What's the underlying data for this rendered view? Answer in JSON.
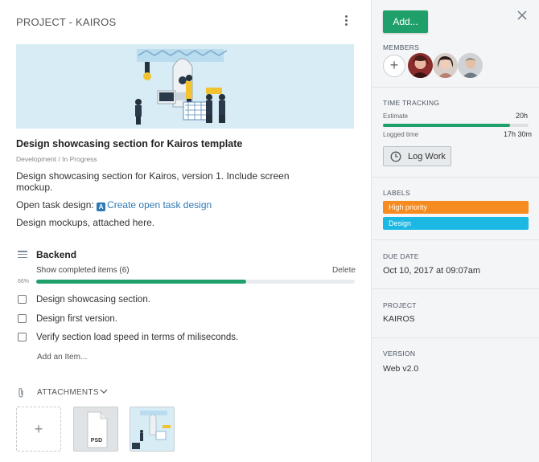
{
  "project": {
    "title": "PROJECT - KAIROS"
  },
  "task": {
    "title": "Design showcasing section for Kairos template",
    "breadcrumb": "Development / In Progress",
    "description": "Design showcasing section for Kairos, version 1. Include screen mockup.",
    "open_task_prefix": "Open task design:",
    "open_task_link": "Create open task design",
    "mockups_note": "Design mockups, attached here."
  },
  "checklist": {
    "title": "Backend",
    "show_completed": "Show completed items (6)",
    "delete_label": "Delete",
    "progress_label": "66%",
    "progress": 0.66,
    "items": [
      {
        "label": "Design showcasing section.",
        "checked": false
      },
      {
        "label": "Design first version.",
        "checked": false
      },
      {
        "label": "Verify section load speed in terms of miliseconds.",
        "checked": false
      }
    ],
    "add_item": "Add an Item..."
  },
  "attachments": {
    "label": "ATTACHMENTS",
    "add_symbol": "+",
    "files": [
      {
        "type": "psd",
        "badge": "PSD"
      },
      {
        "type": "image"
      }
    ]
  },
  "sidebar": {
    "add_button": "Add...",
    "members_label": "MEMBERS",
    "time_tracking_label": "TIME TRACKING",
    "estimate_label": "Estimate",
    "estimate_value": "20h",
    "logged_label": "Logged time",
    "logged_value": "17h 30m",
    "logged_fraction": 0.875,
    "log_work_button": "Log Work",
    "labels_label": "LABELS",
    "labels": [
      {
        "text": "High priority",
        "color": "#f68b1f"
      },
      {
        "text": "Design",
        "color": "#1bb8e3"
      }
    ],
    "due_date_label": "DUE DATE",
    "due_date_value": "Oct 10, 2017 at 09:07am",
    "project_label": "PROJECT",
    "project_value": "KAIROS",
    "version_label": "VERSION",
    "version_value": "Web v2.0"
  },
  "colors": {
    "accent_green": "#1fa06b",
    "link_blue": "#2f79b7",
    "sidebar_bg": "#f4f5f7"
  }
}
